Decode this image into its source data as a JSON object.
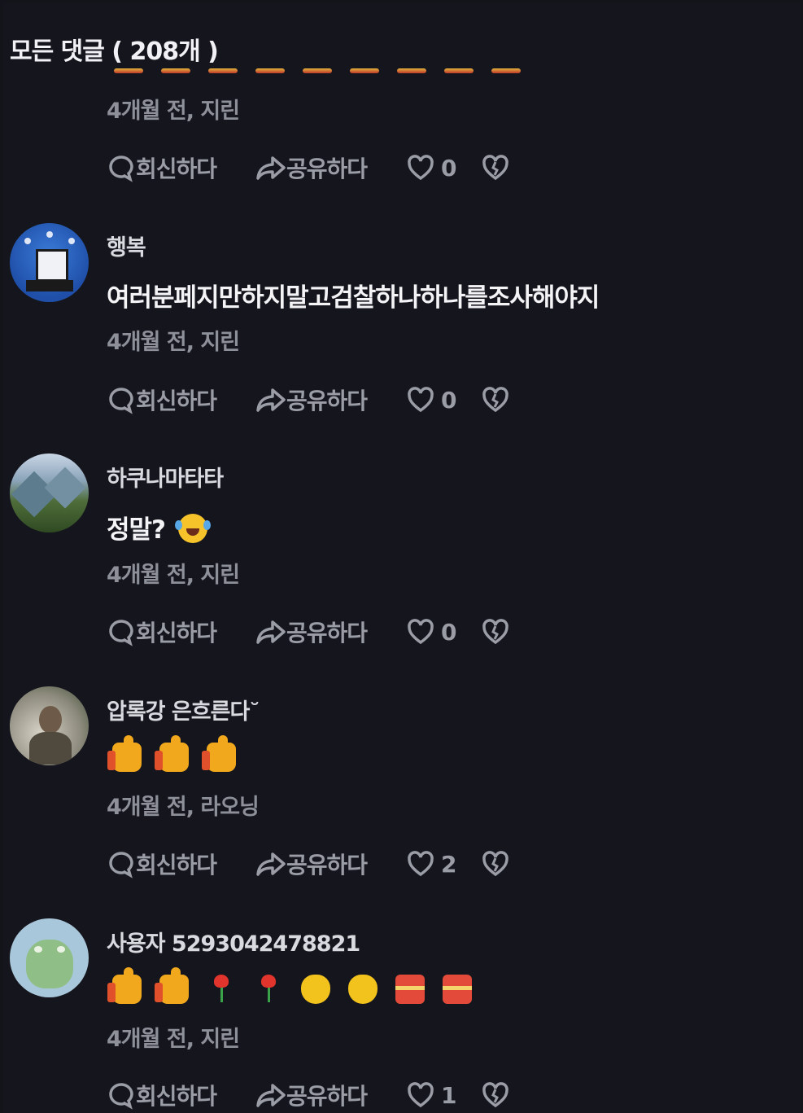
{
  "header": {
    "title": "모든 댓글 ( 208개 )"
  },
  "action_labels": {
    "reply": "회신하다",
    "share": "공유하다"
  },
  "comments": [
    {
      "username": "",
      "text": "",
      "meta": "4개월 전, 지린",
      "likes": "0"
    },
    {
      "username": "행복",
      "text": "여러분페지만하지말고검찰하나하나를조사해야지",
      "meta": "4개월 전, 지린",
      "likes": "0"
    },
    {
      "username": "하쿠나마타타",
      "text": "정말?",
      "meta": "4개월 전, 지린",
      "likes": "0"
    },
    {
      "username": "압록강 은흐른다˘",
      "text": "",
      "meta": "4개월 전, 라오닝",
      "likes": "2"
    },
    {
      "username": "사용자 5293042478821",
      "text": "",
      "meta": "4개월 전, 지린",
      "likes": "1"
    }
  ],
  "colors": {
    "background": "#15161d",
    "muted": "#8d8f99",
    "text": "#f4f4f7"
  }
}
